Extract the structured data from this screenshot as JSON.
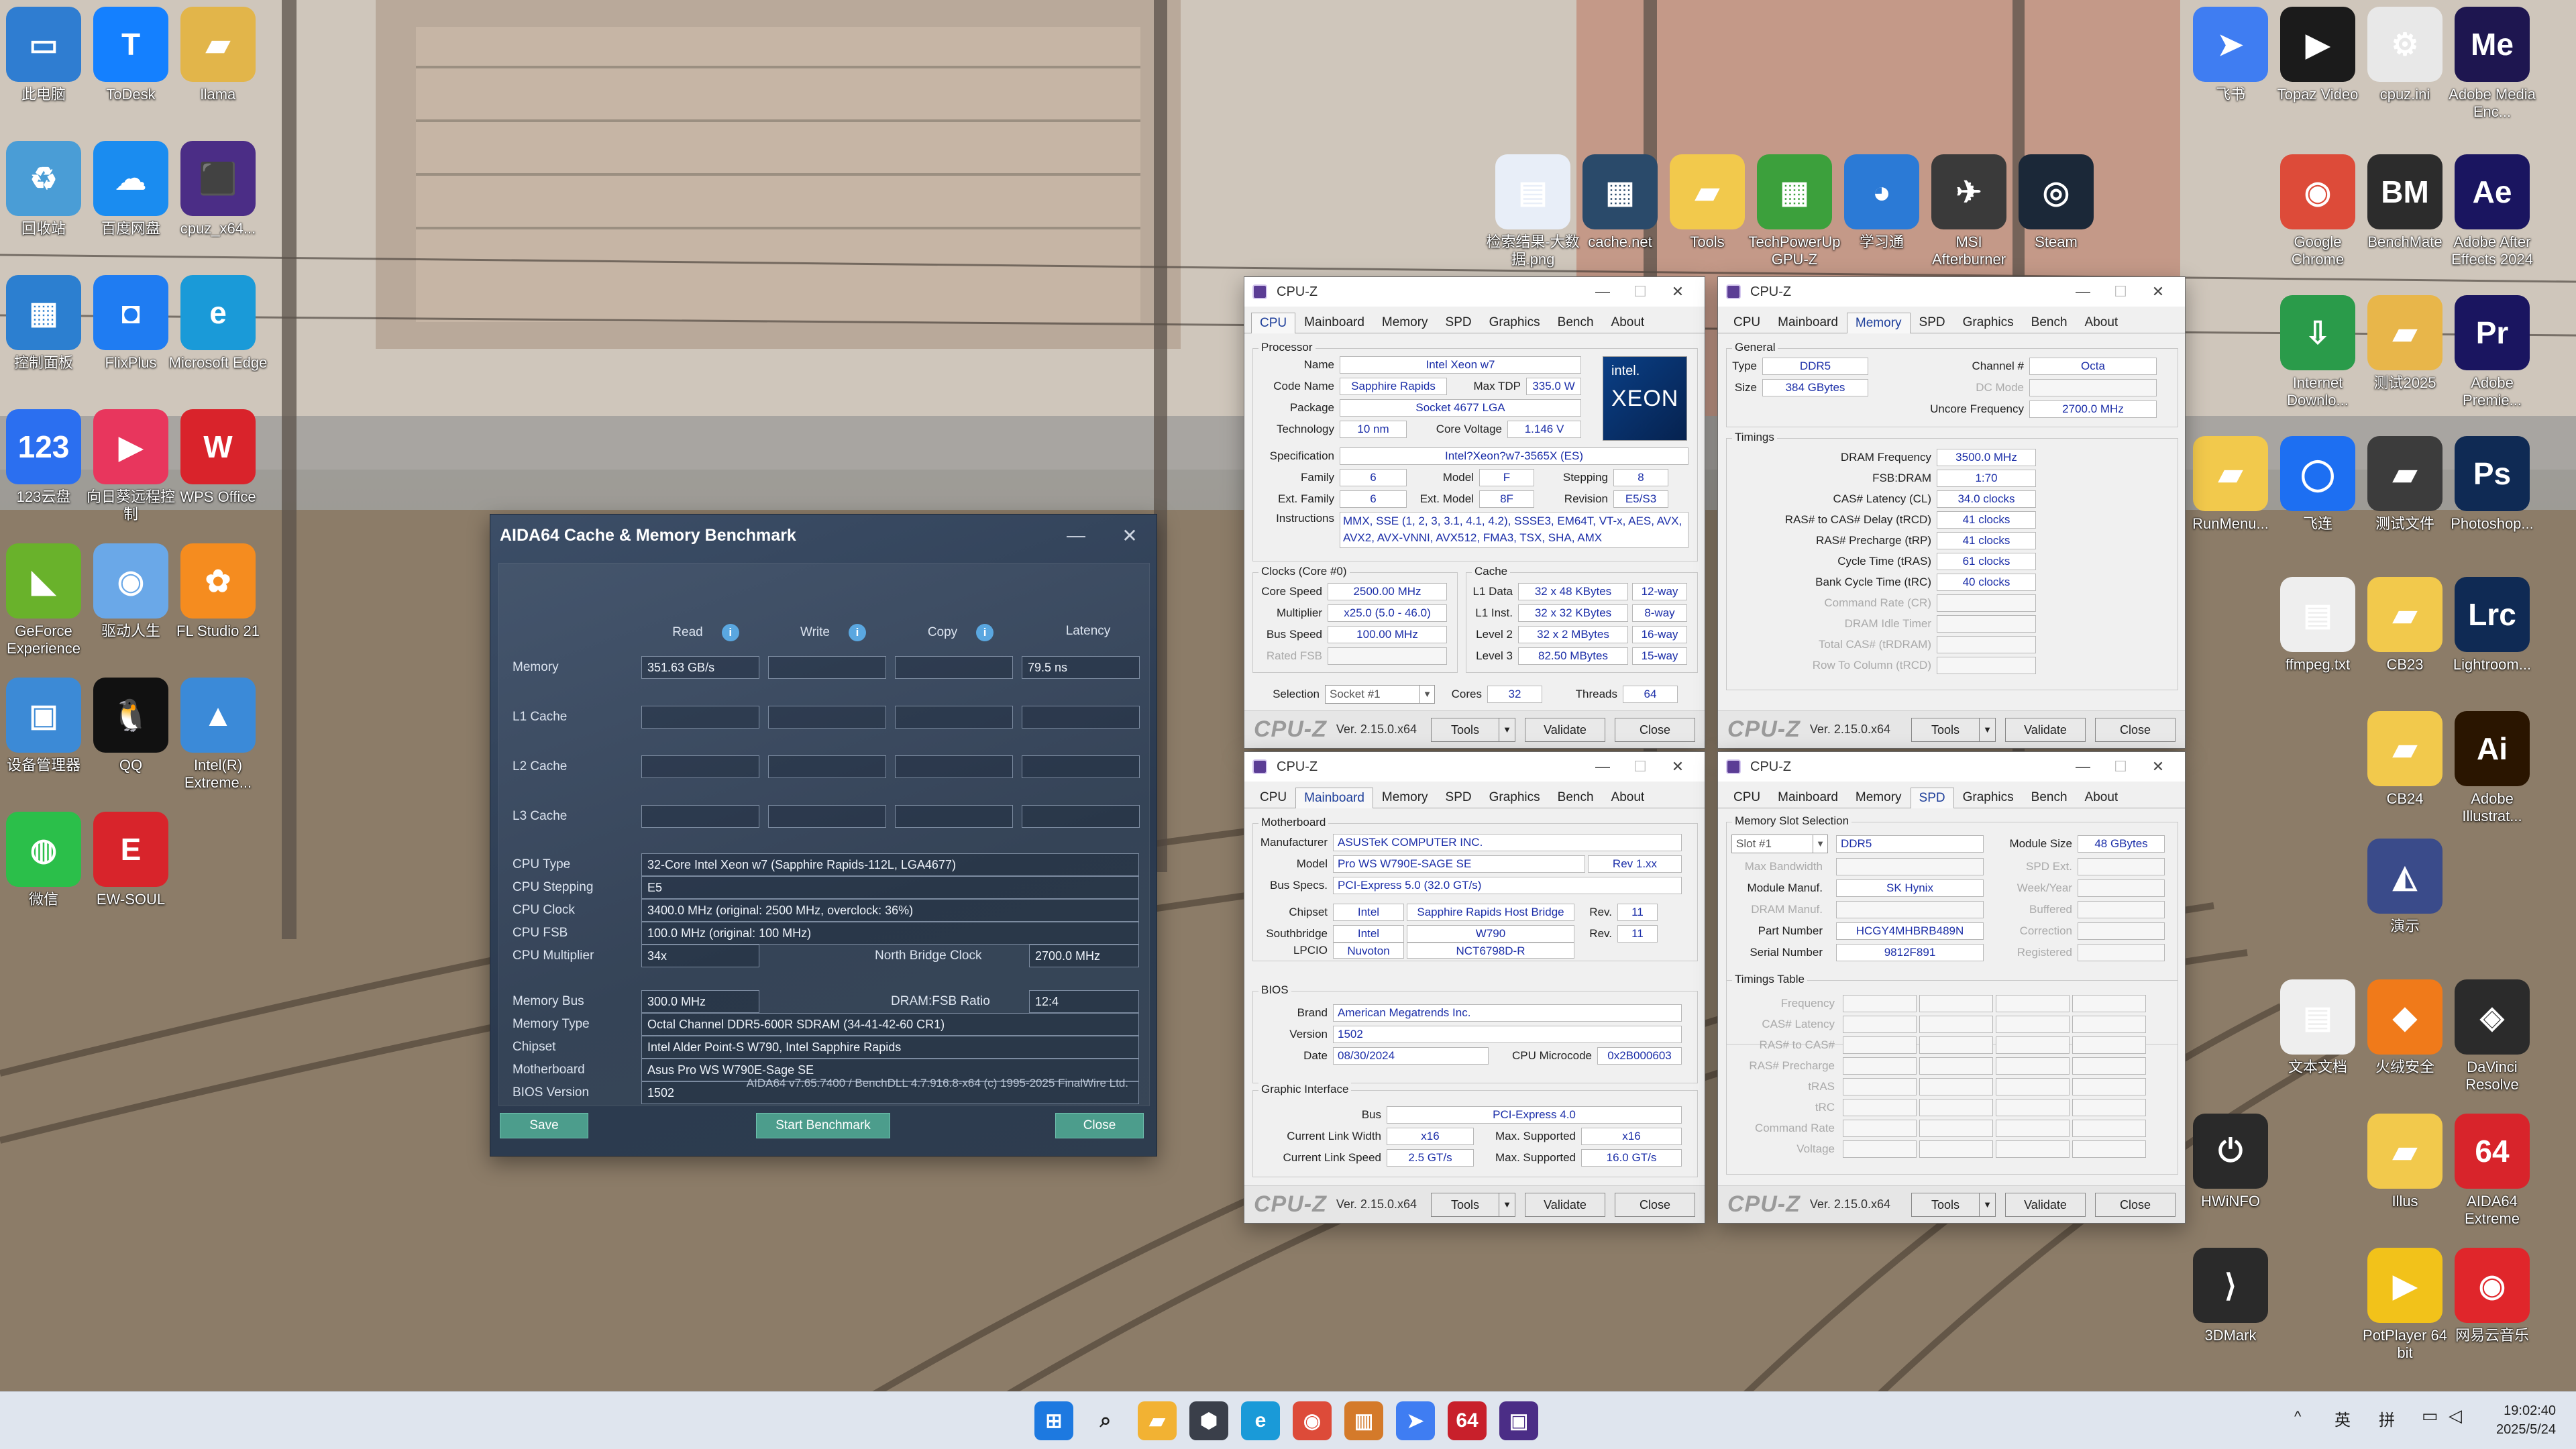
{
  "desktop": {
    "left_icons": [
      {
        "label": "此电脑",
        "color": "#2f7dd1",
        "glyph": "▭"
      },
      {
        "label": "ToDesk",
        "color": "#1480ff",
        "glyph": "T"
      },
      {
        "label": "llama",
        "color": "#e2b54a",
        "glyph": "▰"
      },
      {
        "label": "回收站",
        "color": "#4a9dd6",
        "glyph": "♻"
      },
      {
        "label": "百度网盘",
        "color": "#1a8cf0",
        "glyph": "☁"
      },
      {
        "label": "cpuz_x64...",
        "color": "#4b2d86",
        "glyph": "⬛"
      },
      {
        "label": "控制面板",
        "color": "#2c7fd0",
        "glyph": "▦"
      },
      {
        "label": "FlixPlus",
        "color": "#1f7cf2",
        "glyph": "◘"
      },
      {
        "label": "Microsoft Edge",
        "color": "#1a9ad8",
        "glyph": "e"
      },
      {
        "label": "123云盘",
        "color": "#2b6ff0",
        "glyph": "123"
      },
      {
        "label": "向日葵远程控制",
        "color": "#e8365d",
        "glyph": "▶"
      },
      {
        "label": "WPS Office",
        "color": "#d9232b",
        "glyph": "W"
      },
      {
        "label": "GeForce Experience",
        "color": "#69b22b",
        "glyph": "◣"
      },
      {
        "label": "驱动人生",
        "color": "#6aa8e8",
        "glyph": "◉"
      },
      {
        "label": "FL Studio 21",
        "color": "#f58c1f",
        "glyph": "✿"
      },
      {
        "label": "设备管理器",
        "color": "#3c8ad6",
        "glyph": "▣"
      },
      {
        "label": "QQ",
        "color": "#111111",
        "glyph": "🐧"
      },
      {
        "label": "Intel(R) Extreme...",
        "color": "#3b8ad8",
        "glyph": "▲"
      },
      {
        "label": "微信",
        "color": "#2bbf4a",
        "glyph": "◍"
      },
      {
        "label": "EW-SOUL",
        "color": "#d8242b",
        "glyph": "E"
      }
    ],
    "right_icons": [
      {
        "label": "飞书",
        "color": "#3f7df2",
        "glyph": "➤"
      },
      {
        "label": "Topaz Video",
        "color": "#1b1b1b",
        "glyph": "▶"
      },
      {
        "label": "cpuz.ini",
        "color": "#e8e8e8",
        "glyph": "⚙"
      },
      {
        "label": "Adobe Media Enc...",
        "color": "#1e1650",
        "glyph": "Me"
      },
      {
        "label": "检索结果-大数据.png",
        "color": "#e8eef8",
        "glyph": "▤"
      },
      {
        "label": "cache.net",
        "color": "#2a4a6a",
        "glyph": "▦"
      },
      {
        "label": "Tools",
        "color": "#f2c94c",
        "glyph": "▰"
      },
      {
        "label": "TechPowerUp GPU-Z",
        "color": "#3ca03c",
        "glyph": "▦"
      },
      {
        "label": "学习通",
        "color": "#2b7ad6",
        "glyph": "◕"
      },
      {
        "label": "MSI Afterburner",
        "color": "#3a3a3a",
        "glyph": "✈"
      },
      {
        "label": "Steam",
        "color": "#1b2838",
        "glyph": "◎"
      },
      {
        "label": "Google Chrome",
        "color": "#dd4b39",
        "glyph": "◉"
      },
      {
        "label": "BenchMate",
        "color": "#2c2c2c",
        "glyph": "BM"
      },
      {
        "label": "Adobe After Effects 2024",
        "color": "#1a1560",
        "glyph": "Ae"
      },
      {
        "label": "Internet Downlo...",
        "color": "#2a9b4a",
        "glyph": "⇩"
      },
      {
        "label": "测试2025",
        "color": "#e8b64a",
        "glyph": "▰"
      },
      {
        "label": "Adobe Premie...",
        "color": "#1a1560",
        "glyph": "Pr"
      },
      {
        "label": "RunMenu...",
        "color": "#f2c94c",
        "glyph": "▰"
      },
      {
        "label": "飞连",
        "color": "#1d6ff2",
        "glyph": "◯"
      },
      {
        "label": "测试文件",
        "color": "#3c3c3c",
        "glyph": "▰"
      },
      {
        "label": "Photoshop...",
        "color": "#0f2a54",
        "glyph": "Ps"
      },
      {
        "label": "ffmpeg.txt",
        "color": "#eeeeee",
        "glyph": "▤"
      },
      {
        "label": "CB23",
        "color": "#f2c94c",
        "glyph": "▰"
      },
      {
        "label": "Lightroom...",
        "color": "#0f2a54",
        "glyph": "Lrc"
      },
      {
        "label": "CB24",
        "color": "#f2c94c",
        "glyph": "▰"
      },
      {
        "label": "Adobe Illustrat...",
        "color": "#2a1500",
        "glyph": "Ai"
      },
      {
        "label": "演示",
        "color": "#3a4b8a",
        "glyph": "◭"
      },
      {
        "label": "文本文档",
        "color": "#eeeeee",
        "glyph": "▤"
      },
      {
        "label": "火绒安全",
        "color": "#f07a1a",
        "glyph": "◆"
      },
      {
        "label": "DaVinci Resolve",
        "color": "#2b2b2b",
        "glyph": "◈"
      },
      {
        "label": "HWiNFO",
        "color": "#2a2a2a",
        "glyph": "⏻"
      },
      {
        "label": "Illus",
        "color": "#f2c94c",
        "glyph": "▰"
      },
      {
        "label": "AIDA64 Extreme",
        "color": "#d8242b",
        "glyph": "64"
      },
      {
        "label": "3DMark",
        "color": "#2a2a2a",
        "glyph": "⟩"
      },
      {
        "label": "PotPlayer 64 bit",
        "color": "#f2c21a",
        "glyph": "▶"
      },
      {
        "label": "网易云音乐",
        "color": "#e0262b",
        "glyph": "◉"
      }
    ]
  },
  "aida": {
    "title": "AIDA64 Cache & Memory Benchmark",
    "col_read": "Read",
    "col_write": "Write",
    "col_copy": "Copy",
    "col_latency": "Latency",
    "rows": [
      {
        "label": "Memory",
        "read": "351.63 GB/s",
        "write": "",
        "copy": "",
        "latency": "79.5 ns"
      },
      {
        "label": "L1 Cache",
        "read": "",
        "write": "",
        "copy": "",
        "latency": ""
      },
      {
        "label": "L2 Cache",
        "read": "",
        "write": "",
        "copy": "",
        "latency": ""
      },
      {
        "label": "L3 Cache",
        "read": "",
        "write": "",
        "copy": "",
        "latency": ""
      }
    ],
    "cpu_type_label": "CPU Type",
    "cpu_type": "32-Core Intel Xeon w7  (Sapphire Rapids-112L, LGA4677)",
    "cpu_stepping_label": "CPU Stepping",
    "cpu_stepping": "E5",
    "cpu_clock_label": "CPU Clock",
    "cpu_clock": "3400.0 MHz  (original: 2500 MHz, overclock: 36%)",
    "cpu_fsb_label": "CPU FSB",
    "cpu_fsb": "100.0 MHz  (original: 100 MHz)",
    "cpu_mult_label": "CPU Multiplier",
    "cpu_mult": "34x",
    "nb_clock_label": "North Bridge Clock",
    "nb_clock": "2700.0 MHz",
    "mem_bus_label": "Memory Bus",
    "mem_bus": "300.0 MHz",
    "dram_fsb_label": "DRAM:FSB Ratio",
    "dram_fsb": "12:4",
    "mem_type_label": "Memory Type",
    "mem_type": "Octal Channel DDR5-600R SDRAM  (34-41-42-60 CR1)",
    "chipset_label": "Chipset",
    "chipset": "Intel Alder Point-S W790, Intel Sapphire Rapids",
    "mobo_label": "Motherboard",
    "mobo": "Asus Pro WS W790E-Sage SE",
    "bios_label": "BIOS Version",
    "bios": "1502",
    "footer": "AIDA64 v7.65.7400 / BenchDLL 4.7.916.8-x64  (c) 1995-2025 FinalWire Ltd.",
    "save": "Save",
    "start": "Start Benchmark",
    "close": "Close"
  },
  "cpuz_common": {
    "title": "CPU-Z",
    "logo": "CPU-Z",
    "version": "Ver. 2.15.0.x64",
    "tools": "Tools",
    "validate": "Validate",
    "close": "Close",
    "tabs": [
      "CPU",
      "Mainboard",
      "Memory",
      "SPD",
      "Graphics",
      "Bench",
      "About"
    ]
  },
  "cpuz_cpu": {
    "processor_title": "Processor",
    "name_label": "Name",
    "name": "Intel Xeon w7",
    "codename_label": "Code Name",
    "codename": "Sapphire Rapids",
    "maxtdp_label": "Max TDP",
    "maxtdp": "335.0 W",
    "package_label": "Package",
    "package": "Socket 4677 LGA",
    "tech_label": "Technology",
    "tech": "10 nm",
    "corev_label": "Core Voltage",
    "corev": "1.146 V",
    "spec_label": "Specification",
    "spec": "Intel?Xeon?w7-3565X (ES)",
    "family_label": "Family",
    "family": "6",
    "model_label": "Model",
    "model": "F",
    "stepping_label": "Stepping",
    "stepping": "8",
    "extfam_label": "Ext. Family",
    "extfam": "6",
    "extmodel_label": "Ext. Model",
    "extmodel": "8F",
    "rev_label": "Revision",
    "rev": "E5/S3",
    "instr_label": "Instructions",
    "instr1": "MMX, SSE (1, 2, 3, 3.1, 4.1, 4.2), SSSE3, EM64T, VT-x, AES, AVX,",
    "instr2": "AVX2, AVX-VNNI, AVX512, FMA3, TSX, SHA, AMX",
    "logo_brand": "intel.",
    "logo_line": "XEON",
    "clocks_title": "Clocks (Core #0)",
    "corespeed_label": "Core Speed",
    "corespeed": "2500.00 MHz",
    "mult_label": "Multiplier",
    "mult": "x25.0 (5.0 - 46.0)",
    "busspeed_label": "Bus Speed",
    "busspeed": "100.00 MHz",
    "ratedfsb_label": "Rated FSB",
    "ratedfsb": "",
    "cache_title": "Cache",
    "l1d_label": "L1 Data",
    "l1d": "32 x 48 KBytes",
    "l1d_way": "12-way",
    "l1i_label": "L1 Inst.",
    "l1i": "32 x 32 KBytes",
    "l1i_way": "8-way",
    "l2_label": "Level 2",
    "l2": "32 x 2 MBytes",
    "l2_way": "16-way",
    "l3_label": "Level 3",
    "l3": "82.50 MBytes",
    "l3_way": "15-way",
    "selection_label": "Selection",
    "selection": "Socket #1",
    "cores_label": "Cores",
    "cores": "32",
    "threads_label": "Threads",
    "threads": "64"
  },
  "cpuz_mem": {
    "general_title": "General",
    "type_label": "Type",
    "type": "DDR5",
    "channel_label": "Channel #",
    "channel": "Octa",
    "size_label": "Size",
    "size": "384 GBytes",
    "dcmode_label": "DC Mode",
    "dcmode": "",
    "uncore_label": "Uncore Frequency",
    "uncore": "2700.0 MHz",
    "timings_title": "Timings",
    "timings": [
      {
        "label": "DRAM Frequency",
        "value": "3500.0 MHz",
        "dim": false
      },
      {
        "label": "FSB:DRAM",
        "value": "1:70",
        "dim": false
      },
      {
        "label": "CAS# Latency (CL)",
        "value": "34.0 clocks",
        "dim": false
      },
      {
        "label": "RAS# to CAS# Delay (tRCD)",
        "value": "41 clocks",
        "dim": false
      },
      {
        "label": "RAS# Precharge (tRP)",
        "value": "41 clocks",
        "dim": false
      },
      {
        "label": "Cycle Time (tRAS)",
        "value": "61 clocks",
        "dim": false
      },
      {
        "label": "Bank Cycle Time (tRC)",
        "value": "40 clocks",
        "dim": false
      },
      {
        "label": "Command Rate (CR)",
        "value": "",
        "dim": true
      },
      {
        "label": "DRAM Idle Timer",
        "value": "",
        "dim": true
      },
      {
        "label": "Total CAS# (tRDRAM)",
        "value": "",
        "dim": true
      },
      {
        "label": "Row To Column (tRCD)",
        "value": "",
        "dim": true
      }
    ]
  },
  "cpuz_mb": {
    "mb_title": "Motherboard",
    "manuf_label": "Manufacturer",
    "manuf": "ASUSTeK COMPUTER INC.",
    "model_label": "Model",
    "model": "Pro WS W790E-SAGE SE",
    "model_rev": "Rev 1.xx",
    "busspecs_label": "Bus Specs.",
    "busspecs": "PCI-Express 5.0 (32.0 GT/s)",
    "chipset_label": "Chipset",
    "chipset_v": "Intel",
    "chipset_n": "Sapphire Rapids Host Bridge",
    "chipset_rev_label": "Rev.",
    "chipset_rev": "11",
    "sb_label": "Southbridge",
    "sb_v": "Intel",
    "sb_n": "W790",
    "sb_rev_label": "Rev.",
    "sb_rev": "11",
    "lpcio_label": "LPCIO",
    "lpcio_v": "Nuvoton",
    "lpcio_n": "NCT6798D-R",
    "bios_title": "BIOS",
    "brand_label": "Brand",
    "brand": "American Megatrends Inc.",
    "version_label": "Version",
    "version": "1502",
    "date_label": "Date",
    "date": "08/30/2024",
    "ucode_label": "CPU Microcode",
    "ucode": "0x2B000603",
    "gi_title": "Graphic Interface",
    "bus_label": "Bus",
    "bus": "PCI-Express 4.0",
    "clw_label": "Current Link Width",
    "clw": "x16",
    "msw_label": "Max. Supported",
    "msw": "x16",
    "cls_label": "Current Link Speed",
    "cls": "2.5 GT/s",
    "mss_label": "Max. Supported",
    "mss": "16.0 GT/s"
  },
  "cpuz_spd": {
    "slot_title": "Memory Slot Selection",
    "slot": "Slot #1",
    "slot_type": "DDR5",
    "modsize_label": "Module Size",
    "modsize": "48 GBytes",
    "maxbw_label": "Max Bandwidth",
    "maxbw": "",
    "spdext_label": "SPD Ext.",
    "spdext": "",
    "manuf_label": "Module Manuf.",
    "manuf": "SK Hynix",
    "week_label": "Week/Year",
    "week": "",
    "dram_label": "DRAM Manuf.",
    "dram": "",
    "buff_label": "Buffered",
    "buff": "",
    "part_label": "Part Number",
    "part": "HCGY4MHBRB489N",
    "corr_label": "Correction",
    "corr": "",
    "serial_label": "Serial Number",
    "serial": "9812F891",
    "reg_label": "Registered",
    "reg": "",
    "tt_title": "Timings Table",
    "tt_rows": [
      "Frequency",
      "CAS# Latency",
      "RAS# to CAS#",
      "RAS# Precharge",
      "tRAS",
      "tRC",
      "Command Rate",
      "Voltage"
    ]
  },
  "taskbar": {
    "ime1": "英",
    "ime2": "拼",
    "time": "19:02:40",
    "date": "2025/5/24",
    "apps": [
      {
        "name": "start-button",
        "color": "#1d79e0",
        "glyph": "⊞"
      },
      {
        "name": "search-button",
        "color": "#333333",
        "glyph": "⌕"
      },
      {
        "name": "file-explorer",
        "color": "#f2b233",
        "glyph": "▰"
      },
      {
        "name": "app-cube",
        "color": "#3a3f4a",
        "glyph": "⬢"
      },
      {
        "name": "edge",
        "color": "#1a9ad8",
        "glyph": "e"
      },
      {
        "name": "chrome",
        "color": "#dd4b39",
        "glyph": "◉"
      },
      {
        "name": "app-doc",
        "color": "#d47a2a",
        "glyph": "▥"
      },
      {
        "name": "feishu",
        "color": "#3f7df2",
        "glyph": "➤"
      },
      {
        "name": "aida64",
        "color": "#c8202b",
        "glyph": "64"
      },
      {
        "name": "cpuz",
        "color": "#4b2d86",
        "glyph": "▣"
      }
    ]
  }
}
